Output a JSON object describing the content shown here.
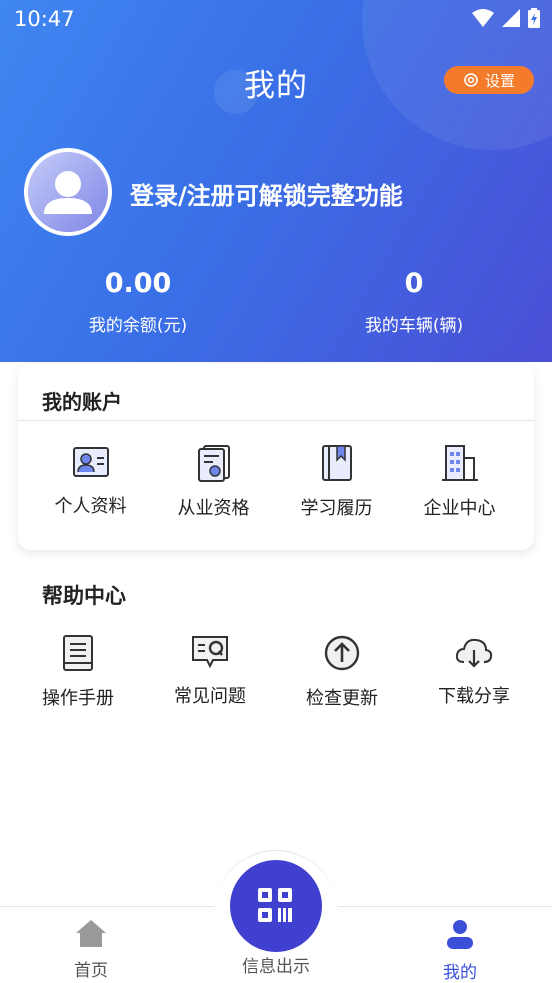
{
  "status_bar": {
    "time": "10:47"
  },
  "header": {
    "title": "我的",
    "settings_label": "设置",
    "login_prompt": "登录/注册可解锁完整功能",
    "stats": [
      {
        "value": "0.00",
        "label": "我的余额(元)"
      },
      {
        "value": "0",
        "label": "我的车辆(辆)"
      }
    ]
  },
  "account": {
    "title": "我的账户",
    "items": [
      {
        "label": "个人资料",
        "icon": "profile-card-icon"
      },
      {
        "label": "从业资格",
        "icon": "certificate-icon"
      },
      {
        "label": "学习履历",
        "icon": "book-icon"
      },
      {
        "label": "企业中心",
        "icon": "building-icon"
      }
    ]
  },
  "help": {
    "title": "帮助中心",
    "items": [
      {
        "label": "操作手册",
        "icon": "manual-icon"
      },
      {
        "label": "常见问题",
        "icon": "faq-icon"
      },
      {
        "label": "检查更新",
        "icon": "update-arrow-icon"
      },
      {
        "label": "下载分享",
        "icon": "cloud-download-icon"
      }
    ]
  },
  "bottom_nav": {
    "items": [
      {
        "label": "首页",
        "icon": "home-icon"
      },
      {
        "label": "信息出示",
        "icon": "qr-scan-icon"
      },
      {
        "label": "我的",
        "icon": "person-icon"
      }
    ],
    "active_index": 2
  },
  "colors": {
    "header_gradient_start": "#3f86f2",
    "header_gradient_end": "#4b4fd6",
    "settings_orange": "#f37b2a",
    "nav_active": "#3b4fd8",
    "icon_blue": "#4f6be8"
  }
}
